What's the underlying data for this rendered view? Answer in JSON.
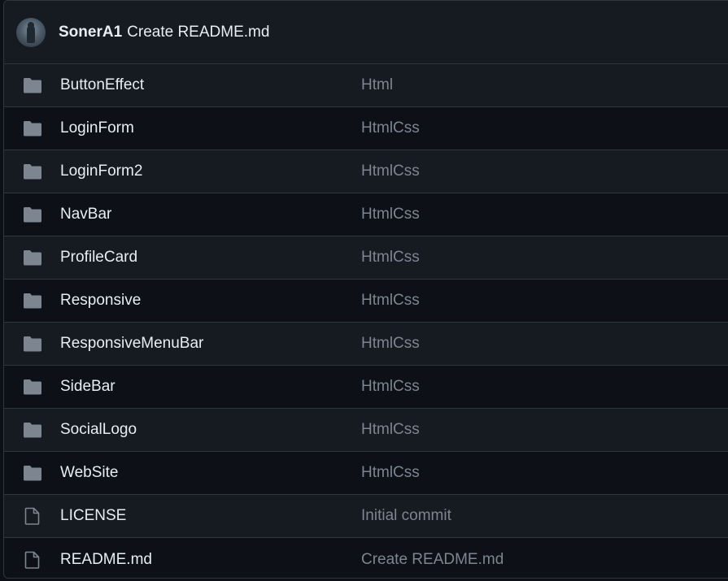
{
  "commit": {
    "author": "SonerA1",
    "message": "Create README.md"
  },
  "files": [
    {
      "type": "folder",
      "icon": "folder-icon",
      "name": "ButtonEffect",
      "message": "Html"
    },
    {
      "type": "folder",
      "icon": "folder-icon",
      "name": "LoginForm",
      "message": "HtmlCss"
    },
    {
      "type": "folder",
      "icon": "folder-icon",
      "name": "LoginForm2",
      "message": "HtmlCss"
    },
    {
      "type": "folder",
      "icon": "folder-icon",
      "name": "NavBar",
      "message": "HtmlCss"
    },
    {
      "type": "folder",
      "icon": "folder-icon",
      "name": "ProfileCard",
      "message": "HtmlCss"
    },
    {
      "type": "folder",
      "icon": "folder-icon",
      "name": "Responsive",
      "message": "HtmlCss"
    },
    {
      "type": "folder",
      "icon": "folder-icon",
      "name": "ResponsiveMenuBar",
      "message": "HtmlCss"
    },
    {
      "type": "folder",
      "icon": "folder-icon",
      "name": "SideBar",
      "message": "HtmlCss"
    },
    {
      "type": "folder",
      "icon": "folder-icon",
      "name": "SocialLogo",
      "message": "HtmlCss"
    },
    {
      "type": "folder",
      "icon": "folder-icon",
      "name": "WebSite",
      "message": "HtmlCss"
    },
    {
      "type": "file",
      "icon": "file-icon",
      "name": "LICENSE",
      "message": "Initial commit"
    },
    {
      "type": "file",
      "icon": "file-icon",
      "name": "README.md",
      "message": "Create README.md"
    }
  ],
  "colors": {
    "background": "#0d1117",
    "row_alt": "#161b22",
    "border": "#30363d",
    "text_primary": "#e6edf3",
    "text_muted": "#7d8590",
    "icon": "#7d8590"
  }
}
